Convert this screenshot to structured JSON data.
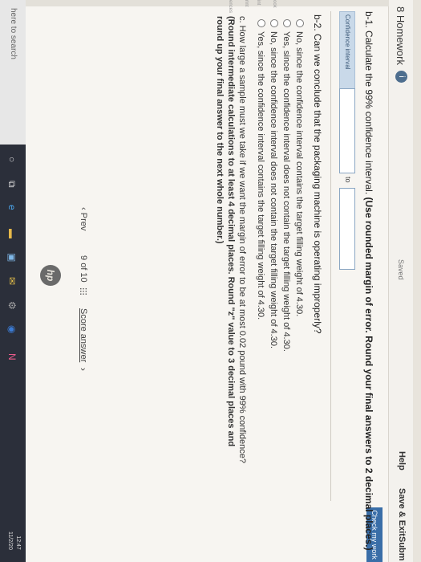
{
  "header": {
    "title": "8 Homework",
    "info_icon": "i",
    "saved": "Saved",
    "help": "Help",
    "save_exit": "Save & Exit",
    "submit": "Subm",
    "check_work": "Check my work"
  },
  "side_labels": [
    "ook",
    "int",
    "rint",
    "ences"
  ],
  "question_b1": {
    "prefix": "b-1.",
    "text": "Calculate the 99% confidence interval.",
    "instruction": "(Use rounded margin of error. Round your final answers to 2 decimal places.)",
    "ci_label": "Confidence interval",
    "to_label": "to",
    "lower_value": "",
    "upper_value": ""
  },
  "question_b2": {
    "text": "b-2. Can we conclude that the packaging machine is operating improperly?",
    "options": [
      "No, since the confidence interval contains the target filling weight of 4.30.",
      "Yes, since the confidence interval does not contain the target filling weight of 4.30.",
      "No, since the confidence interval does not contain the target filling weight of 4.30.",
      "Yes, since the confidence interval contains the target filling weight of 4.30."
    ]
  },
  "question_c": {
    "prefix": "c. How large a sample must we take if we want the margin of error to be at most 0.02 pound with 99% confidence?",
    "instruction": "(Round intermediate calculations to at least 4 decimal places. Round \"z\" value to 3 decimal places and round up your final answer to the next whole number.)"
  },
  "pager": {
    "prev": "Prev",
    "page": "9",
    "of": "of 10",
    "score_answer": "Score answer"
  },
  "taskbar": {
    "search": "here to search",
    "time": "12:47",
    "date": "11/2/20"
  },
  "brand": "hp"
}
